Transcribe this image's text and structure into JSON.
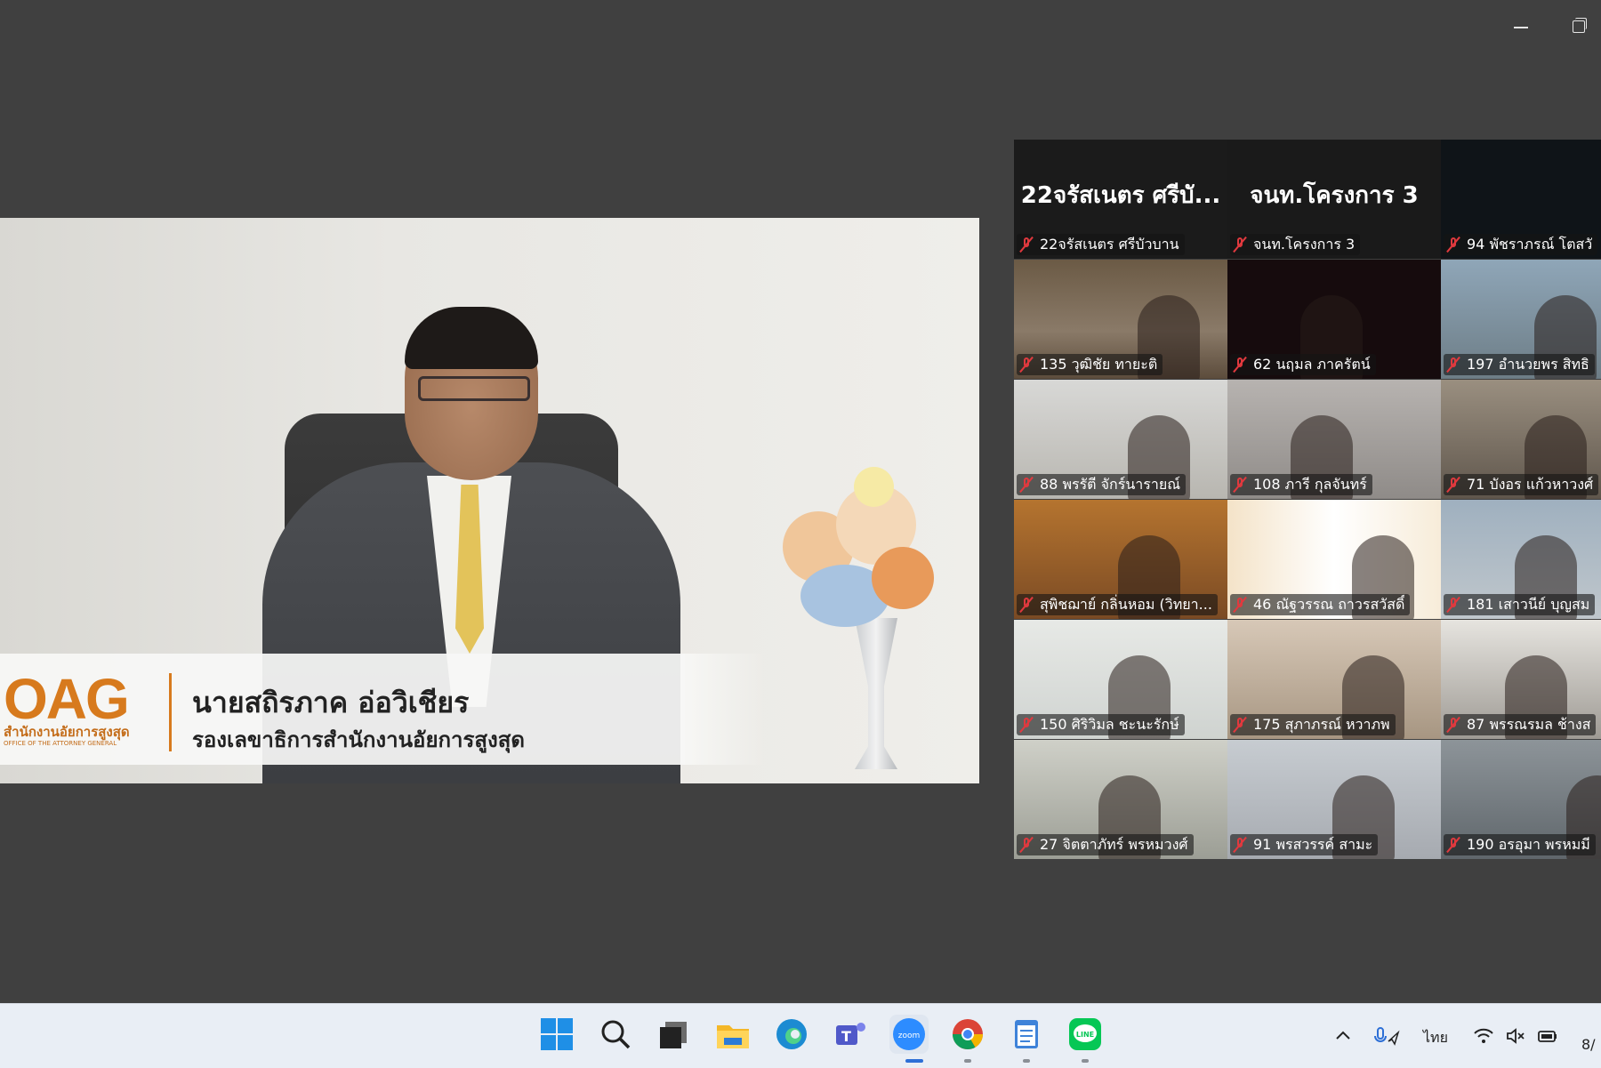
{
  "window": {
    "controls": [
      "minimize",
      "restore"
    ]
  },
  "speaker": {
    "name": "นายสถิรภาค  อ่อวิเชียร",
    "title": "รองเลขาธิการสำนักงานอัยการสูงสุด",
    "logo": {
      "letters": "OAG",
      "thai": "สำนักงานอัยการสูงสุด",
      "english": "OFFICE OF THE ATTORNEY GENERAL"
    }
  },
  "gallery": {
    "active_color": "#24d36b",
    "tiles": [
      {
        "big": "22จรัสเนตร ศรีบั...",
        "label": "22จรัสเนตร ศรีบัวบาน",
        "muted": true,
        "active": true
      },
      {
        "big": "จนท.โครงการ 3",
        "label": "จนท.โครงการ 3",
        "muted": true
      },
      {
        "big": "",
        "label": "94 พัชราภรณ์ โตสวั",
        "muted": true
      },
      {
        "label": "135 วุฒิชัย ทายะติ",
        "muted": true
      },
      {
        "label": "62 นฤมล ภาครัตน์",
        "muted": true
      },
      {
        "label": "197 อำนวยพร สิทธิ",
        "muted": true
      },
      {
        "label": "88 พรรัตี จักร์นารายณ์",
        "muted": true
      },
      {
        "label": "108 ภารี กุลจันทร์",
        "muted": true
      },
      {
        "label": "71 บังอร แก้วหาวงศ์",
        "muted": true
      },
      {
        "label": "สุพิชฌาย์ กลิ่นหอม (วิทยา...",
        "muted": true
      },
      {
        "label": "46 ณัฐวรรณ ถาวรสวัสดิ์",
        "muted": true
      },
      {
        "label": "181 เสาวนีย์ บุญสม",
        "muted": true
      },
      {
        "label": "150 ศิริวิมล ชะนะรักษ์",
        "muted": true
      },
      {
        "label": "175 สุภาภรณ์ หวาภพ",
        "muted": true
      },
      {
        "label": "87 พรรณรมล ช้างส",
        "muted": true
      },
      {
        "label": "27 จิตตาภัทร์ พรหมวงศ์",
        "muted": true
      },
      {
        "label": "91 พรสวรรค์ สามะ",
        "muted": true
      },
      {
        "label": "190 อรอุมา พรหมมี",
        "muted": true
      }
    ]
  },
  "taskbar": {
    "apps": [
      "windows-start",
      "search",
      "task-view",
      "file-explorer",
      "edge",
      "teams",
      "zoom",
      "chrome",
      "notepad",
      "line"
    ],
    "zoom_label": "zoom",
    "line_label": "LINE",
    "tray": {
      "language": "ไทย",
      "time": "8/"
    }
  }
}
